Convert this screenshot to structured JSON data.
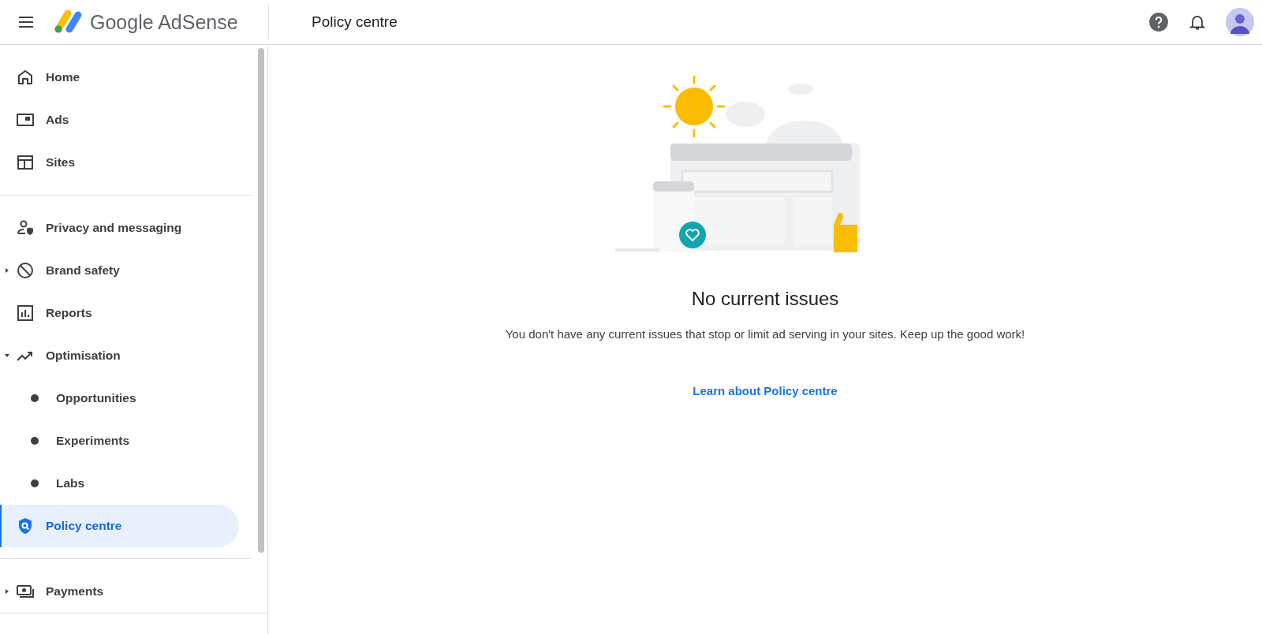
{
  "header": {
    "product": "Google AdSense",
    "page_title": "Policy centre"
  },
  "sidebar": {
    "sections": [
      {
        "items": [
          {
            "label": "Home",
            "selected": false
          },
          {
            "label": "Ads",
            "selected": false
          },
          {
            "label": "Sites",
            "selected": false
          }
        ]
      },
      {
        "items": [
          {
            "label": "Privacy and messaging",
            "selected": false
          },
          {
            "label": "Brand safety",
            "selected": false,
            "expanded": false
          },
          {
            "label": "Reports",
            "selected": false
          },
          {
            "label": "Optimisation",
            "selected": false,
            "expanded": true,
            "children": [
              {
                "label": "Opportunities",
                "selected": false
              },
              {
                "label": "Experiments",
                "selected": false
              },
              {
                "label": "Labs",
                "selected": false
              }
            ]
          },
          {
            "label": "Policy centre",
            "selected": true
          }
        ]
      },
      {
        "items": [
          {
            "label": "Payments",
            "selected": false,
            "expanded": false
          }
        ]
      }
    ]
  },
  "main": {
    "title": "No current issues",
    "message": "You don't have any current issues that stop or limit ad serving in your sites. Keep up the good work!",
    "link": "Learn about Policy centre"
  }
}
